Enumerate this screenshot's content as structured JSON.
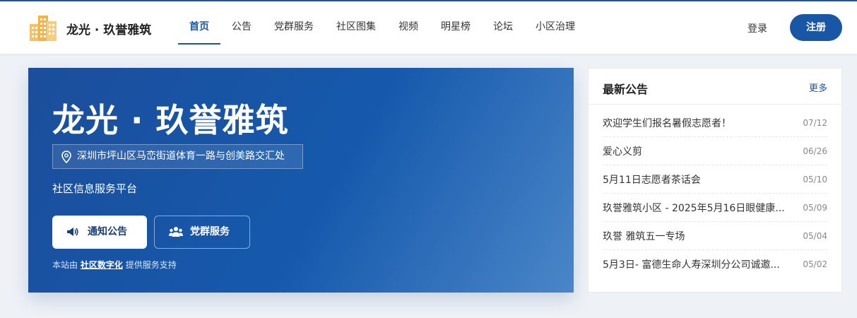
{
  "brand": {
    "name": "龙光 · 玖誉雅筑",
    "logo_icon": "building-icon"
  },
  "nav": {
    "items": [
      {
        "label": "首页",
        "active": true
      },
      {
        "label": "公告",
        "active": false
      },
      {
        "label": "党群服务",
        "active": false
      },
      {
        "label": "社区图集",
        "active": false
      },
      {
        "label": "视频",
        "active": false
      },
      {
        "label": "明星榜",
        "active": false
      },
      {
        "label": "论坛",
        "active": false
      },
      {
        "label": "小区治理",
        "active": false
      }
    ]
  },
  "auth": {
    "login_label": "登录",
    "register_label": "注册"
  },
  "hero": {
    "title": "龙光 · 玖誉雅筑",
    "address": "深圳市坪山区马峦街道体育一路与创美路交汇处",
    "address_icon": "location-pin-icon",
    "subtitle": "社区信息服务平台",
    "notice_button": "通知公告",
    "notice_icon": "megaphone-icon",
    "party_button": "党群服务",
    "party_icon": "users-icon",
    "powered_prefix": "本站由",
    "powered_link": "社区数字化",
    "powered_suffix": "提供服务支持"
  },
  "announcements": {
    "title": "最新公告",
    "more_label": "更多",
    "items": [
      {
        "title": "欢迎学生们报名暑假志愿者！",
        "date": "07/12"
      },
      {
        "title": "爱心义剪",
        "date": "06/26"
      },
      {
        "title": "5月11日志愿者茶话会",
        "date": "05/10"
      },
      {
        "title": "玖誉雅筑小区 - 2025年5月16日眼健康...",
        "date": "05/09"
      },
      {
        "title": "玖誉 雅筑五一专场",
        "date": "05/04"
      },
      {
        "title": "5月3日- 富德生命人寿深圳分公司诚邀...",
        "date": "05/02"
      }
    ]
  },
  "colors": {
    "primary": "#1a56a6",
    "hero_start": "#1b4e9b",
    "hero_end": "#4a86c8",
    "logo": "#f5b342"
  }
}
